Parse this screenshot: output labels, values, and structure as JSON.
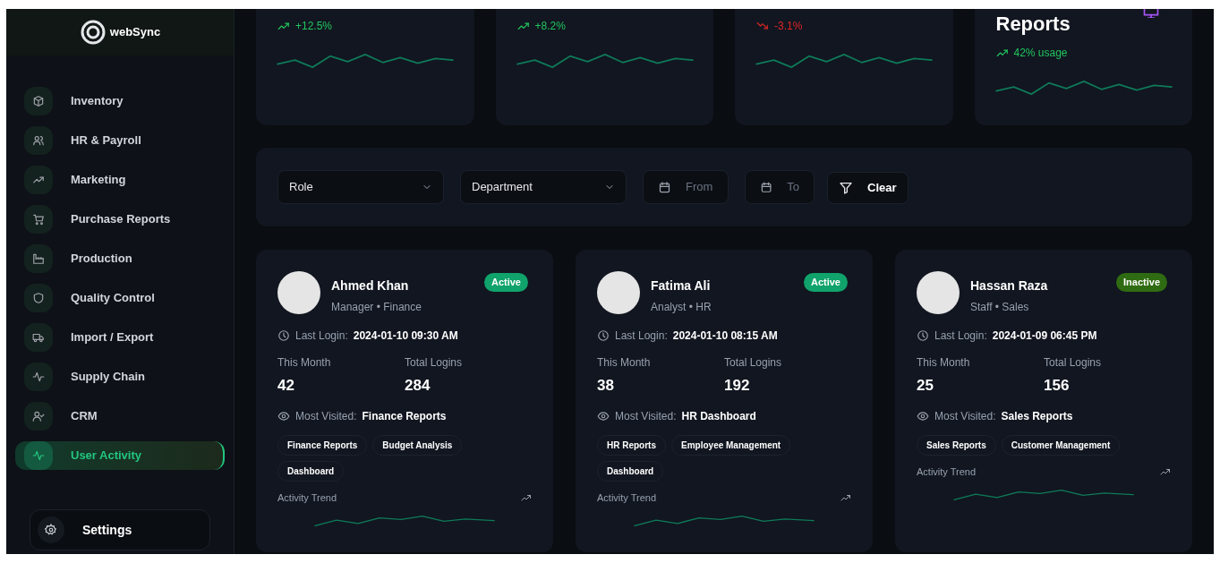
{
  "sidebar": {
    "logo": {
      "name": "webSync"
    },
    "items": [
      {
        "label": "Inventory",
        "selected": false
      },
      {
        "label": "HR & Payroll",
        "selected": false
      },
      {
        "label": "Marketing",
        "selected": false
      },
      {
        "label": "Purchase Reports",
        "selected": false
      },
      {
        "label": "Production",
        "selected": false
      },
      {
        "label": "Quality Control",
        "selected": false
      },
      {
        "label": "Import / Export",
        "selected": false
      },
      {
        "label": "Supply Chain",
        "selected": false
      },
      {
        "label": "CRM",
        "selected": false
      },
      {
        "label": "User Activity",
        "selected": true
      }
    ],
    "settings": {
      "label": "Settings"
    }
  },
  "stats": [
    {
      "trend": "+12.5%",
      "kind": "up"
    },
    {
      "trend": "+8.2%",
      "kind": "up"
    },
    {
      "trend": "-3.1%",
      "kind": "down"
    },
    {
      "title": "Reports",
      "trend": "42% usage",
      "kind": "up"
    }
  ],
  "filters": {
    "role": {
      "placeholder": "Role"
    },
    "department": {
      "placeholder": "Department"
    },
    "from": {
      "placeholder": "From"
    },
    "to": {
      "placeholder": "To"
    },
    "clear": "Clear"
  },
  "users": [
    {
      "name": "Ahmed Khan",
      "role": "Manager • Finance",
      "status": {
        "label": "Active",
        "active": true
      },
      "last_login_label": "Last Login:",
      "last_login": "2024-01-10 09:30 AM",
      "this_month_label": "This Month",
      "this_month": "42",
      "total_label": "Total Logins",
      "total": "284",
      "most_visited_label": "Most Visited:",
      "most_visited": "Finance Reports",
      "tags": [
        "Finance Reports",
        "Budget Analysis",
        "Dashboard"
      ],
      "trend_label": "Activity Trend"
    },
    {
      "name": "Fatima Ali",
      "role": "Analyst • HR",
      "status": {
        "label": "Active",
        "active": true
      },
      "last_login_label": "Last Login:",
      "last_login": "2024-01-10 08:15 AM",
      "this_month_label": "This Month",
      "this_month": "38",
      "total_label": "Total Logins",
      "total": "192",
      "most_visited_label": "Most Visited:",
      "most_visited": "HR Dashboard",
      "tags": [
        "HR Reports",
        "Employee Management",
        "Dashboard"
      ],
      "trend_label": "Activity Trend"
    },
    {
      "name": "Hassan Raza",
      "role": "Staff • Sales",
      "status": {
        "label": "Inactive",
        "active": false
      },
      "last_login_label": "Last Login:",
      "last_login": "2024-01-09 06:45 PM",
      "this_month_label": "This Month",
      "this_month": "25",
      "total_label": "Total Logins",
      "total": "156",
      "most_visited_label": "Most Visited:",
      "most_visited": "Sales Reports",
      "tags": [
        "Sales Reports",
        "Customer Management"
      ],
      "trend_label": "Activity Trend"
    }
  ]
}
